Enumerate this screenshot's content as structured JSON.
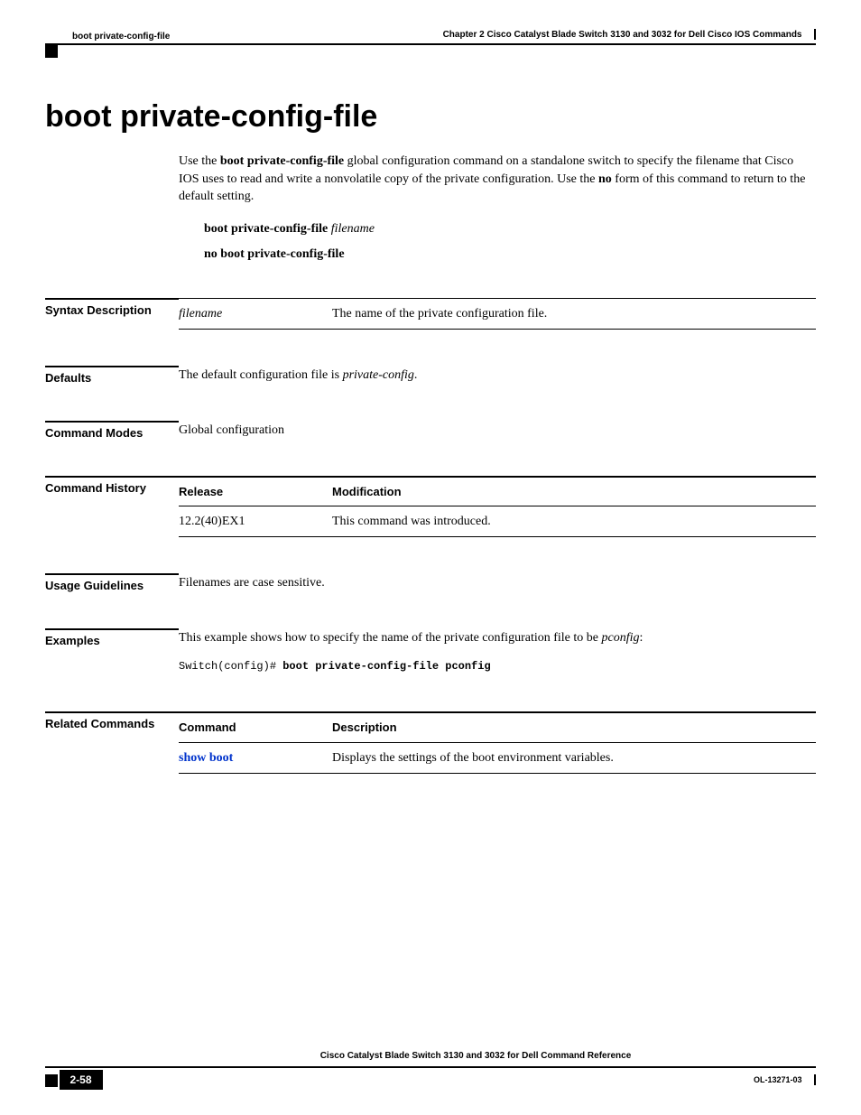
{
  "header": {
    "left": "boot private-config-file",
    "right": "Chapter 2     Cisco Catalyst Blade Switch 3130 and 3032 for Dell Cisco IOS Commands"
  },
  "title": "boot private-config-file",
  "intro": {
    "part1": "Use the ",
    "cmd1": "boot private-config-file",
    "part2": " global configuration command on a standalone switch to specify the filename that Cisco IOS uses to read and write a nonvolatile copy of the private configuration. Use the ",
    "cmd2": "no",
    "part3": " form of this command to return to the default setting."
  },
  "syntax": {
    "line1_cmd": "boot private-config-file",
    "line1_arg": "filename",
    "line2_cmd": "no boot private-config-file"
  },
  "sections": {
    "syntax_desc": {
      "label": "Syntax Description",
      "param": "filename",
      "desc": "The name of the private configuration file."
    },
    "defaults": {
      "label": "Defaults",
      "text1": "The default configuration file is ",
      "italic": "private-config",
      "text2": "."
    },
    "modes": {
      "label": "Command Modes",
      "text": "Global configuration"
    },
    "history": {
      "label": "Command History",
      "col1": "Release",
      "col2": "Modification",
      "row1_rel": "12.2(40)EX1",
      "row1_mod": "This command was introduced."
    },
    "usage": {
      "label": "Usage Guidelines",
      "text": "Filenames are case sensitive."
    },
    "examples": {
      "label": "Examples",
      "text1": "This example shows how to specify the name of the private configuration file to be ",
      "italic": "pconfig",
      "text2": ":",
      "code_prompt": "Switch(config)# ",
      "code_cmd": "boot private-config-file pconfig"
    },
    "related": {
      "label": "Related Commands",
      "col1": "Command",
      "col2": "Description",
      "row1_cmd": "show boot",
      "row1_desc": "Displays the settings of the boot environment variables."
    }
  },
  "footer": {
    "title": "Cisco Catalyst Blade Switch 3130 and 3032 for Dell Command Reference",
    "page": "2-58",
    "docid": "OL-13271-03"
  }
}
